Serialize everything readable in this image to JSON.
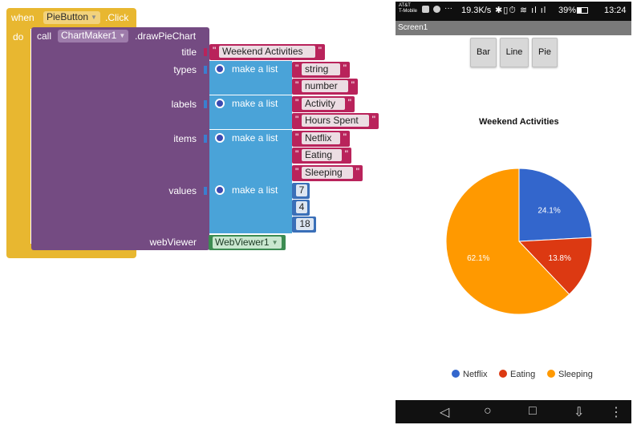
{
  "blocks": {
    "event": {
      "when": "when",
      "component": "PieButton",
      "event_name": ".Click",
      "do": "do"
    },
    "call": {
      "keyword": "call",
      "component": "ChartMaker1",
      "method": ".drawPieChart"
    },
    "params": {
      "title": "title",
      "types": "types",
      "labels": "labels",
      "items": "items",
      "values": "values",
      "webviewer": "webViewer"
    },
    "make_list": "make a list",
    "title_text": "Weekend Activities",
    "types_list": [
      "string",
      "number"
    ],
    "labels_list": [
      "Activity",
      "Hours Spent"
    ],
    "items_list": [
      "Netflix",
      "Eating",
      "Sleeping"
    ],
    "values_list": [
      "7",
      "4",
      "18"
    ],
    "webviewer_component": "WebViewer1"
  },
  "phone": {
    "status": {
      "carrier": "AT&T",
      "carrier2": "T-Mobile",
      "speed": "19.3K/s",
      "battery": "39%",
      "time": "13:24"
    },
    "screen_title": "Screen1",
    "buttons": [
      "Bar",
      "Line",
      "Pie"
    ]
  },
  "chart_data": {
    "type": "pie",
    "title": "Weekend Activities",
    "categories": [
      "Netflix",
      "Eating",
      "Sleeping"
    ],
    "values": [
      7,
      4,
      18
    ],
    "percent_labels": [
      "24.1%",
      "13.8%",
      "62.1%"
    ],
    "colors": [
      "#3366cc",
      "#dc3912",
      "#ff9900"
    ],
    "legend_position": "bottom"
  }
}
